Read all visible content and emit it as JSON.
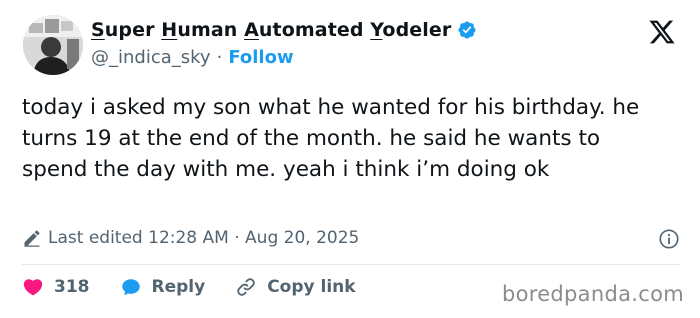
{
  "author": {
    "name_parts": [
      {
        "text": "S",
        "u": true
      },
      {
        "text": "uper ",
        "u": false
      },
      {
        "text": "H",
        "u": true
      },
      {
        "text": "uman ",
        "u": false
      },
      {
        "text": "A",
        "u": true
      },
      {
        "text": "utomated ",
        "u": false
      },
      {
        "text": "Y",
        "u": true
      },
      {
        "text": "odeler",
        "u": false
      }
    ],
    "handle": "@_indica_sky",
    "separator": "·",
    "follow_label": "Follow",
    "verified_icon": "verified-badge-icon"
  },
  "tweet": {
    "text": "today i asked my son what he wanted for his birthday. he turns 19 at the end of the month. he said he wants to spend the day with me. yeah i think i’m doing ok"
  },
  "meta": {
    "edited_label": "Last edited",
    "time": "12:28 AM",
    "separator": "·",
    "date": "Aug 20, 2025"
  },
  "actions": {
    "like_count": "318",
    "reply_label": "Reply",
    "copy_link_label": "Copy link"
  },
  "watermark": "boredpanda.com",
  "colors": {
    "accent": "#1d9bf0",
    "like": "#f91880",
    "secondary_text": "#536471",
    "primary_text": "#0f1419"
  }
}
